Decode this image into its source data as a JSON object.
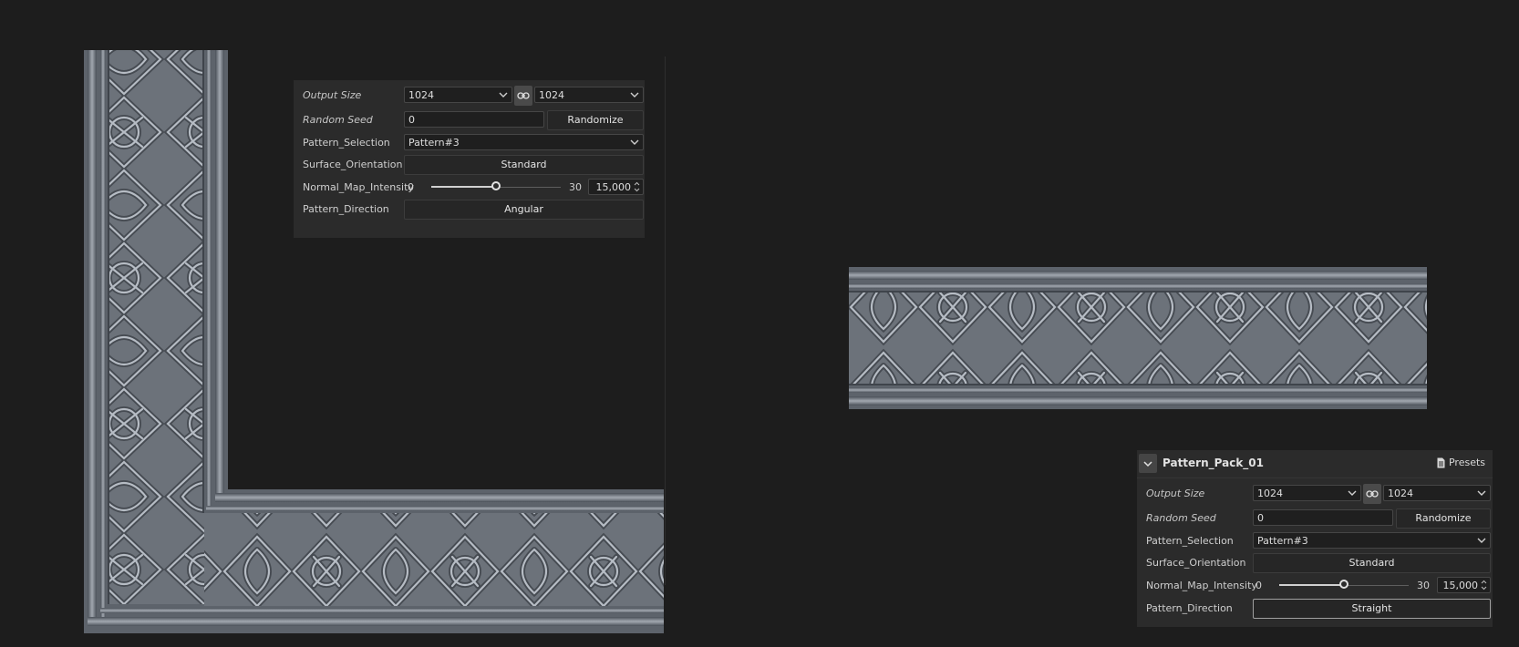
{
  "panel_a": {
    "output_size": {
      "label": "Output Size",
      "width": "1024",
      "height": "1024"
    },
    "random_seed": {
      "label": "Random Seed",
      "value": "0",
      "button": "Randomize"
    },
    "pattern_selection": {
      "label": "Pattern_Selection",
      "value": "Pattern#3"
    },
    "surface_orientation": {
      "label": "Surface_Orientation",
      "value": "Standard"
    },
    "normal_map_intensity": {
      "label": "Normal_Map_Intensity",
      "min": "0",
      "max": "30",
      "value": "15,000",
      "level": 0.5
    },
    "pattern_direction": {
      "label": "Pattern_Direction",
      "value": "Angular"
    }
  },
  "panel_b": {
    "title": "Pattern_Pack_01",
    "presets_label": "Presets",
    "output_size": {
      "label": "Output Size",
      "width": "1024",
      "height": "1024"
    },
    "random_seed": {
      "label": "Random Seed",
      "value": "0",
      "button": "Randomize"
    },
    "pattern_selection": {
      "label": "Pattern_Selection",
      "value": "Pattern#3"
    },
    "surface_orientation": {
      "label": "Surface_Orientation",
      "value": "Standard"
    },
    "normal_map_intensity": {
      "label": "Normal_Map_Intensity",
      "min": "0",
      "max": "30",
      "value": "15,000",
      "level": 0.5
    },
    "pattern_direction": {
      "label": "Pattern_Direction",
      "value": "Straight"
    }
  },
  "icons": {
    "link": "link-icon",
    "chevron": "chevron-down-icon",
    "collapse": "collapse-chevron-icon",
    "presets": "document-icon",
    "spin": "spin-arrows-icon"
  },
  "colors": {
    "canvas": "#1d1d1d",
    "panel": "#2b2b2b",
    "texture": "#6d737b"
  }
}
